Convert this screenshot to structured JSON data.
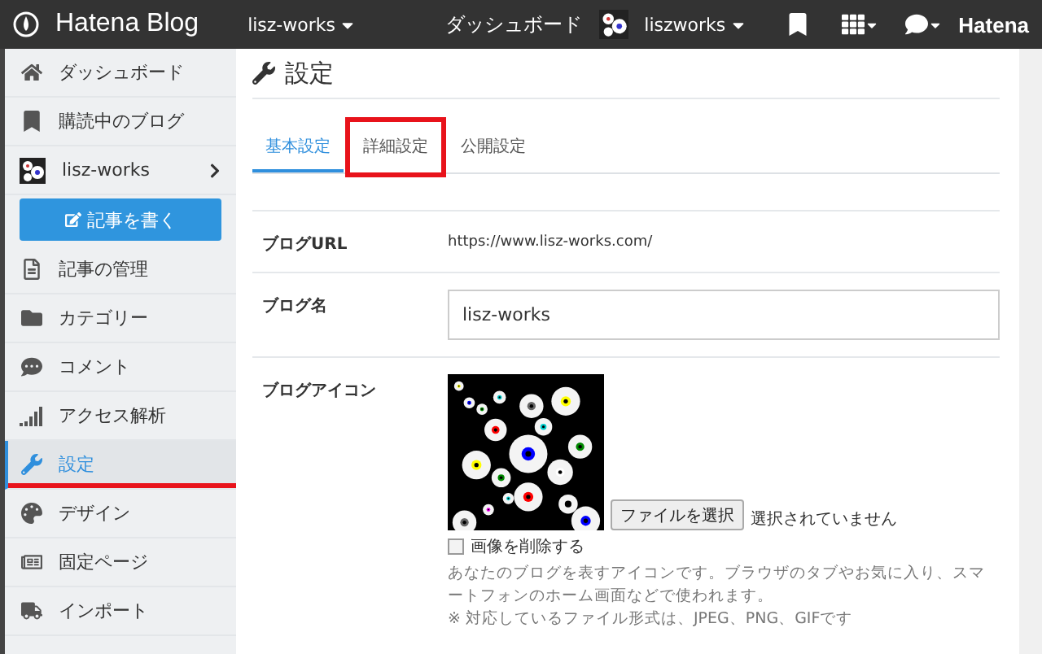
{
  "topbar": {
    "brand": "Hatena Blog",
    "blog_menu": "lisz-works",
    "dashboard": "ダッシュボード",
    "user": "liszworks",
    "hatena": "Hatena"
  },
  "sidebar": {
    "items": [
      {
        "kind": "nav",
        "label": "ダッシュボード",
        "selected": false,
        "highlighted": false
      },
      {
        "kind": "nav",
        "label": "購読中のブログ",
        "selected": false,
        "highlighted": false
      },
      {
        "kind": "blog",
        "label": "lisz-works",
        "selected": false,
        "highlighted": false
      },
      {
        "kind": "write",
        "label": "記事を書く"
      },
      {
        "kind": "nav",
        "label": "記事の管理",
        "selected": false,
        "highlighted": false
      },
      {
        "kind": "nav",
        "label": "カテゴリー",
        "selected": false,
        "highlighted": false
      },
      {
        "kind": "nav",
        "label": "コメント",
        "selected": false,
        "highlighted": false
      },
      {
        "kind": "nav",
        "label": "アクセス解析",
        "selected": false,
        "highlighted": false
      },
      {
        "kind": "nav",
        "label": "設定",
        "selected": true,
        "highlighted": true
      },
      {
        "kind": "nav",
        "label": "デザイン",
        "selected": false,
        "highlighted": false
      },
      {
        "kind": "nav",
        "label": "固定ページ",
        "selected": false,
        "highlighted": false
      },
      {
        "kind": "nav",
        "label": "インポート",
        "selected": false,
        "highlighted": false
      }
    ]
  },
  "page": {
    "title": "設定",
    "tabs": [
      {
        "label": "基本設定",
        "selected": true,
        "highlighted": false
      },
      {
        "label": "詳細設定",
        "selected": false,
        "highlighted": true
      },
      {
        "label": "公開設定",
        "selected": false,
        "highlighted": false
      }
    ],
    "rows": [
      {
        "kind": "text",
        "label": "ブログURL",
        "value": "https://www.lisz-works.com/"
      },
      {
        "kind": "input",
        "label": "ブログ名",
        "value": "lisz-works"
      },
      {
        "kind": "icon",
        "label": "ブログアイコン",
        "file_button": "ファイルを選択",
        "file_status": "選択されていません",
        "delete_label": "画像を削除する",
        "delete_checked": false,
        "help": [
          "あなたのブログを表すアイコンです。ブラウザのタブやお気に入り、スマートフォンのホーム画面などで使われます。",
          "※ 対応しているファイル形式は、JPEG、PNG、GIFです"
        ]
      }
    ]
  }
}
